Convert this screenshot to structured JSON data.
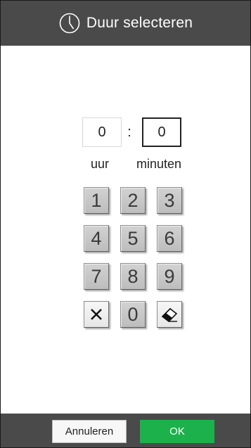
{
  "dialog": {
    "title": "Duur selecteren",
    "icon": "clock-icon"
  },
  "duration": {
    "hours_value": "0",
    "separator": ":",
    "minutes_value": "0",
    "hours_unit": "uur",
    "minutes_unit": "minuten"
  },
  "keypad": {
    "keys": [
      "1",
      "2",
      "3",
      "4",
      "5",
      "6",
      "7",
      "8",
      "9",
      "0"
    ],
    "clear_icon": "close-icon",
    "erase_icon": "eraser-icon"
  },
  "footer": {
    "cancel_label": "Annuleren",
    "ok_label": "OK"
  },
  "colors": {
    "header": "#4a4a4a",
    "ok": "#1cb14b"
  }
}
